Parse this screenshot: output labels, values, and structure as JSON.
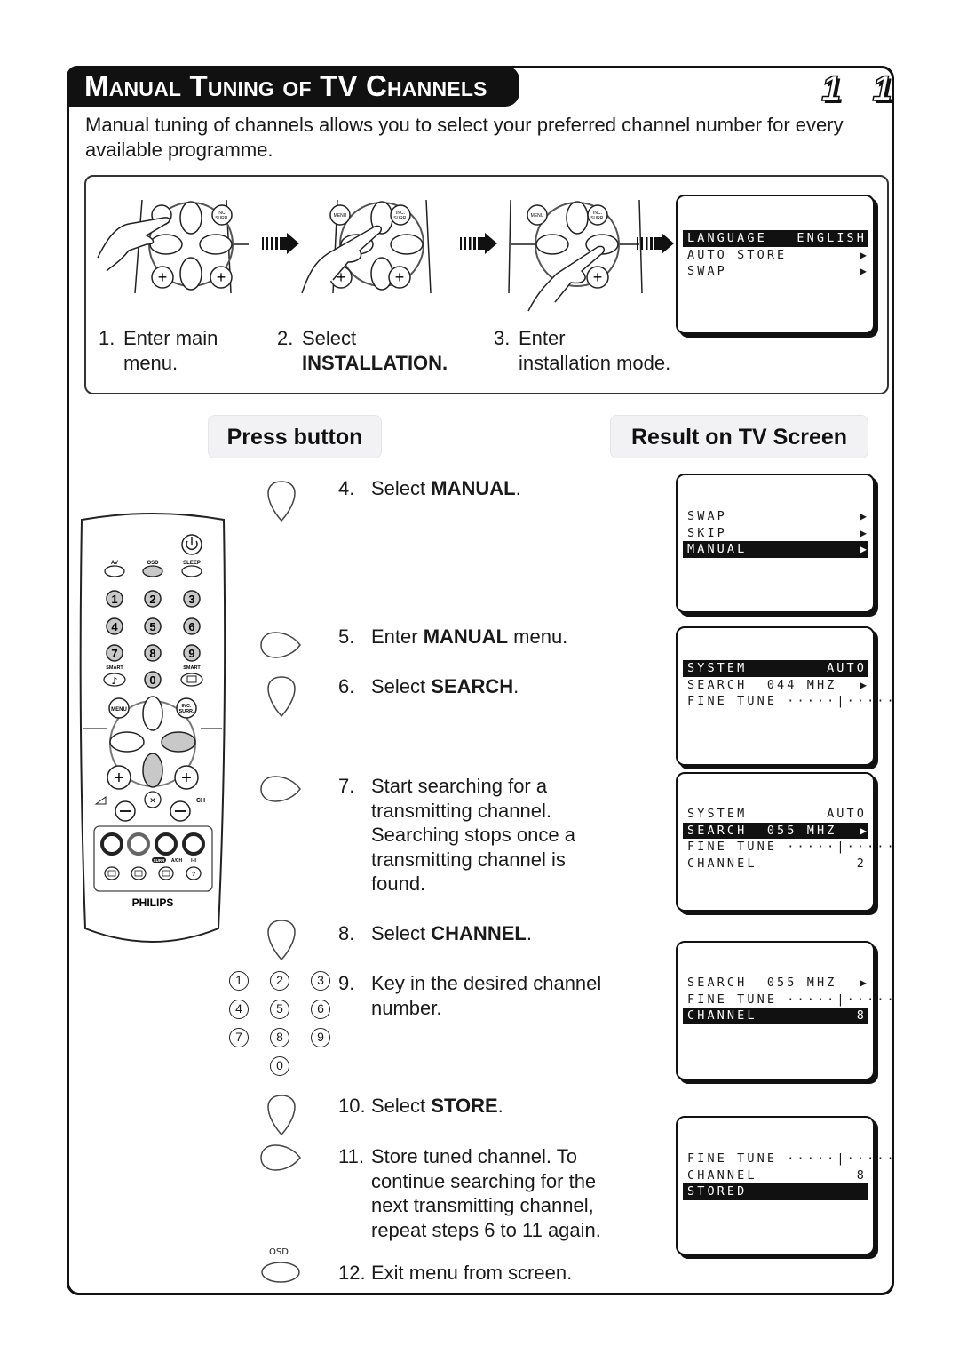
{
  "header": {
    "title": "Manual Tuning of TV Channels",
    "page_number": "1 1"
  },
  "intro": "Manual tuning of channels allows you to select your preferred channel number for every available programme.",
  "intro_steps": [
    {
      "num": "1.",
      "line1": "Enter main",
      "line2": "menu."
    },
    {
      "num": "2.",
      "line1": "Select",
      "line2": "INSTALLATION."
    },
    {
      "num": "3.",
      "line1": "Enter",
      "line2": "installation mode."
    }
  ],
  "remote_illustration_labels": {
    "menu": "MENU",
    "surround": "INC. SURR."
  },
  "columns": {
    "press": "Press button",
    "result": "Result on TV Screen"
  },
  "steps": [
    {
      "num": "4.",
      "pre": "Select ",
      "bold": "MANUAL",
      "post": "."
    },
    {
      "num": "5.",
      "pre": "Enter ",
      "bold": "MANUAL",
      "post": " menu."
    },
    {
      "num": "6.",
      "pre": "Select ",
      "bold": "SEARCH",
      "post": "."
    },
    {
      "num": "7.",
      "pre": "Start searching for a transmitting channel. Searching stops once a transmitting channel is found.",
      "bold": "",
      "post": ""
    },
    {
      "num": "8.",
      "pre": "Select ",
      "bold": "CHANNEL",
      "post": "."
    },
    {
      "num": "9.",
      "pre": "Key in the desired channel number.",
      "bold": "",
      "post": ""
    },
    {
      "num": "10.",
      "pre": "Select ",
      "bold": "STORE",
      "post": "."
    },
    {
      "num": "11.",
      "pre": "Store tuned channel. To continue searching for the next transmitting channel, repeat steps 6 to 11 again.",
      "bold": "",
      "post": ""
    },
    {
      "num": "12.",
      "pre": "Exit menu from screen.",
      "bold": "",
      "post": ""
    }
  ],
  "keypad": [
    "1",
    "2",
    "3",
    "4",
    "5",
    "6",
    "7",
    "8",
    "9",
    "0"
  ],
  "osd_label": "OSD",
  "tv_screens": [
    {
      "rows": [
        {
          "label": "LANGUAGE",
          "value": "ENGLISH",
          "highlight": true
        },
        {
          "label": "AUTO STORE",
          "value": "▶",
          "highlight": false
        },
        {
          "label": "SWAP",
          "value": "▶",
          "highlight": false
        }
      ]
    },
    {
      "rows": [
        {
          "label": "SWAP",
          "value": "▶",
          "highlight": false
        },
        {
          "label": "SKIP",
          "value": "▶",
          "highlight": false
        },
        {
          "label": "MANUAL",
          "value": "▶",
          "highlight": true
        }
      ]
    },
    {
      "rows": [
        {
          "label": "SYSTEM",
          "value": "AUTO",
          "highlight": true
        },
        {
          "label": "SEARCH  044 MHZ",
          "value": "▶",
          "highlight": false
        },
        {
          "label": "FINE TUNE ·····|·····",
          "value": "",
          "highlight": false
        }
      ]
    },
    {
      "rows": [
        {
          "label": "SYSTEM",
          "value": "AUTO",
          "highlight": false
        },
        {
          "label": "SEARCH  055 MHZ",
          "value": "▶",
          "highlight": true
        },
        {
          "label": "FINE TUNE ·····|·····",
          "value": "",
          "highlight": false
        },
        {
          "label": "CHANNEL",
          "value": "2",
          "highlight": false
        }
      ]
    },
    {
      "rows": [
        {
          "label": "SEARCH  055 MHZ",
          "value": "▶",
          "highlight": false
        },
        {
          "label": "FINE TUNE ·····|·····",
          "value": "",
          "highlight": false
        },
        {
          "label": "CHANNEL",
          "value": "8",
          "highlight": true
        }
      ]
    },
    {
      "rows": [
        {
          "label": "FINE TUNE ·····|·····",
          "value": "",
          "highlight": false
        },
        {
          "label": "CHANNEL",
          "value": "8",
          "highlight": false
        },
        {
          "label": "STORED",
          "value": "",
          "highlight": true
        }
      ]
    }
  ],
  "remote": {
    "brand": "PHILIPS",
    "labels": {
      "av": "AV",
      "osd": "OSD",
      "sleep": "SLEEP",
      "smart_left": "SMART",
      "smart_right": "SMART",
      "menu": "MENU",
      "surr": "INC. SURR.",
      "ch": "CH",
      "surr_badge": "SURR",
      "ach": "A/CH",
      "dual": "I-II"
    },
    "digits": [
      "1",
      "2",
      "3",
      "4",
      "5",
      "6",
      "7",
      "8",
      "9",
      "0"
    ]
  }
}
